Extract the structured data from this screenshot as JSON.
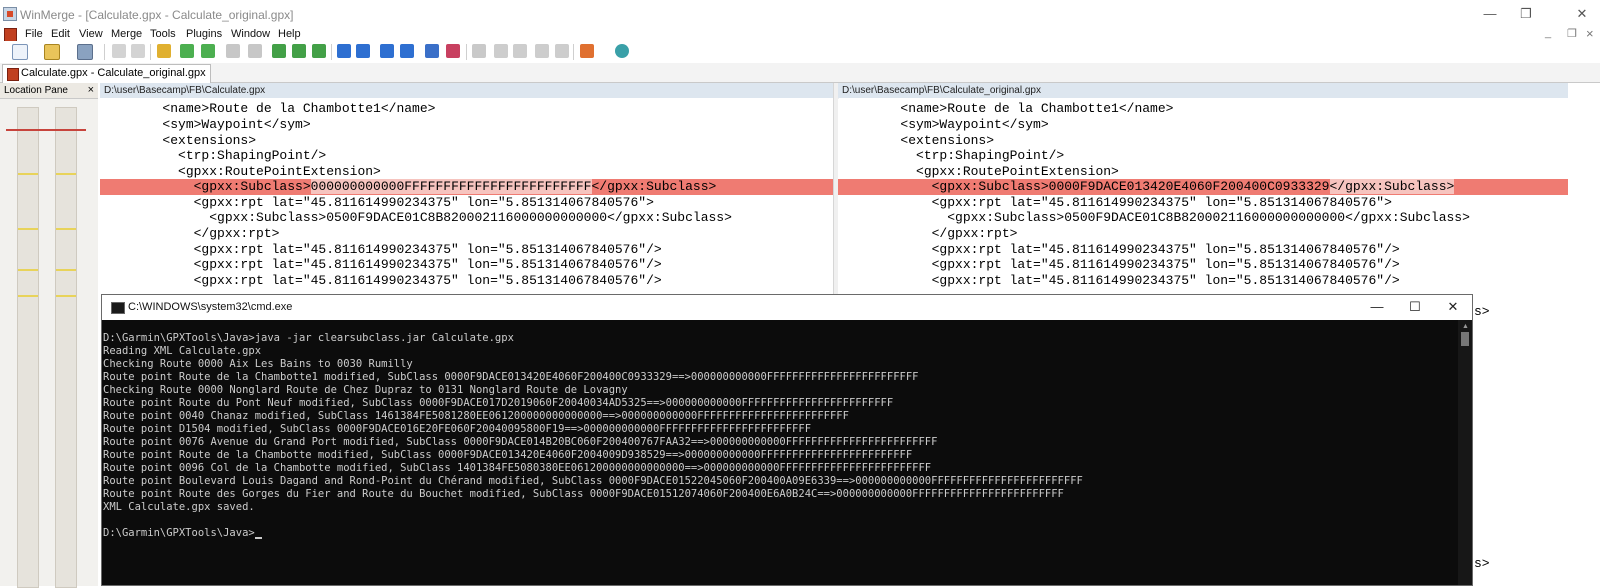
{
  "window": {
    "title": "WinMerge - [Calculate.gpx - Calculate_original.gpx]",
    "minimize_glyph": "—",
    "restore_glyph": "❐",
    "close_glyph": "✕",
    "mdi_minimize_glyph": "_",
    "mdi_restore_glyph": "❐"
  },
  "menu": {
    "items": [
      "File",
      "Edit",
      "View",
      "Merge",
      "Tools",
      "Plugins",
      "Window",
      "Help"
    ],
    "mdi_close": "×"
  },
  "tab": {
    "label": "Calculate.gpx - Calculate_original.gpx"
  },
  "location_pane": {
    "title": "Location Pane",
    "close_glyph": "×"
  },
  "left_pane": {
    "path": "D:\\user\\Basecamp\\FB\\Calculate.gpx",
    "lines": [
      "        <name>Route de la Chambotte1</name>",
      "        <sym>Waypoint</sym>",
      "        <extensions>",
      "          <trp:ShapingPoint/>",
      "          <gpxx:RoutePointExtension>",
      "            <gpxx:Subclass>000000000000FFFFFFFFFFFFFFFFFFFFFFFF</gpxx:Subclass>",
      "            <gpxx:rpt lat=\"45.811614990234375\" lon=\"5.851314067840576\">",
      "              <gpxx:Subclass>0500F9DACE01C8B820002116000000000000</gpxx:Subclass>",
      "            </gpxx:rpt>",
      "            <gpxx:rpt lat=\"45.811614990234375\" lon=\"5.851314067840576\"/>",
      "            <gpxx:rpt lat=\"45.811614990234375\" lon=\"5.851314067840576\"/>",
      "            <gpxx:rpt lat=\"45.811614990234375\" lon=\"5.851314067840576\"/>"
    ],
    "diff_line_parts": [
      "            <gpxx:Subclass>",
      "000000000000FFFFFFFFFFFFFFFFFFFFFFFF",
      "</gpxx:Subclass>"
    ]
  },
  "right_pane": {
    "path": "D:\\user\\Basecamp\\FB\\Calculate_original.gpx",
    "lines": [
      "        <name>Route de la Chambotte1</name>",
      "        <sym>Waypoint</sym>",
      "        <extensions>",
      "          <trp:ShapingPoint/>",
      "          <gpxx:RoutePointExtension>",
      "            <gpxx:Subclass>0000F9DACE013420E4060F200400C0933329</gpxx:Subclass>",
      "            <gpxx:rpt lat=\"45.811614990234375\" lon=\"5.851314067840576\">",
      "              <gpxx:Subclass>0500F9DACE01C8B820002116000000000000</gpxx:Subclass>",
      "            </gpxx:rpt>",
      "            <gpxx:rpt lat=\"45.811614990234375\" lon=\"5.851314067840576\"/>",
      "            <gpxx:rpt lat=\"45.811614990234375\" lon=\"5.851314067840576\"/>",
      "            <gpxx:rpt lat=\"45.811614990234375\" lon=\"5.851314067840576\"/>"
    ],
    "diff_line_parts": [
      "            <gpxx:Subclass>",
      "0000F9DACE013420E4060F200400C0933329",
      "</gpxx:Subclass>"
    ],
    "peek_1": "s>",
    "peek_2": "s>"
  },
  "cmd": {
    "title": "C:\\WINDOWS\\system32\\cmd.exe",
    "minimize_glyph": "—",
    "maximize_glyph": "☐",
    "close_glyph": "✕",
    "lines": [
      "D:\\Garmin\\GPXTools\\Java>java -jar clearsubclass.jar Calculate.gpx",
      "Reading XML Calculate.gpx",
      "Checking Route 0000 Aix Les Bains to 0030 Rumilly",
      "Route point Route de la Chambotte1 modified, SubClass 0000F9DACE013420E4060F200400C0933329==>000000000000FFFFFFFFFFFFFFFFFFFFFFFF",
      "Checking Route 0000 Nonglard Route de Chez Dupraz to 0131 Nonglard Route de Lovagny",
      "Route point Route du Pont Neuf modified, SubClass 0000F9DACE017D2019060F20040034AD5325==>000000000000FFFFFFFFFFFFFFFFFFFFFFFF",
      "Route point 0040 Chanaz modified, SubClass 1461384FE5081280EE061200000000000000==>000000000000FFFFFFFFFFFFFFFFFFFFFFFF",
      "Route point D1504 modified, SubClass 0000F9DACE016E20FE060F20040095800F19==>000000000000FFFFFFFFFFFFFFFFFFFFFFFF",
      "Route point 0076 Avenue du Grand Port modified, SubClass 0000F9DACE014B20BC060F200400767FAA32==>000000000000FFFFFFFFFFFFFFFFFFFFFFFF",
      "Route point Route de la Chambotte modified, SubClass 0000F9DACE013420E4060F2004009D938529==>000000000000FFFFFFFFFFFFFFFFFFFFFFFF",
      "Route point 0096 Col de la Chambotte modified, SubClass 1401384FE5080380EE061200000000000000==>000000000000FFFFFFFFFFFFFFFFFFFFFFFF",
      "Route point Boulevard Louis Dagand and Rond-Point du Chérand modified, SubClass 0000F9DACE01522045060F200400A09E6339==>000000000000FFFFFFFFFFFFFFFFFFFFFFFF",
      "Route point Route des Gorges du Fier and Route du Bouchet modified, SubClass 0000F9DACE01512074060F200400E6A0B24C==>000000000000FFFFFFFFFFFFFFFFFFFFFFFF",
      "XML Calculate.gpx saved.",
      "",
      "D:\\Garmin\\GPXTools\\Java>"
    ]
  },
  "colors": {
    "diff_highlight": "#ef7b72",
    "diff_word": "#f6c4bf",
    "path_header": "#dde6ef",
    "cmd_bg": "#0c0c0c",
    "cmd_text": "#cccccc"
  }
}
